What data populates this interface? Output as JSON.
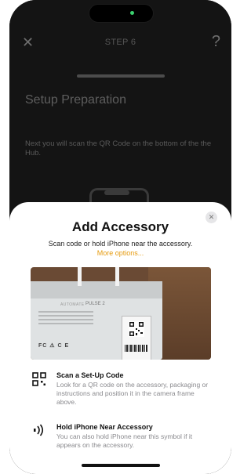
{
  "background": {
    "close_icon": "close-icon",
    "step_label": "STEP 6",
    "help_label": "?",
    "title": "Setup Preparation",
    "description": "Next you will scan the QR Code on the bottom of the the Hub."
  },
  "sheet": {
    "title": "Add Accessory",
    "subtitle": "Scan code or hold iPhone near the accessory.",
    "more_options": "More options...",
    "camera": {
      "brand": "AUTOMATE",
      "model": "PULSE 2",
      "certs": "FC ⚠ C E"
    },
    "rows": [
      {
        "icon": "qr-code-icon",
        "title": "Scan a Set-Up Code",
        "description": "Look for a QR code on the accessory, packaging or instructions and position it in the camera frame above."
      },
      {
        "icon": "nfc-icon",
        "title": "Hold iPhone Near Accessory",
        "description": "You can also hold iPhone near this symbol if it appears on the accessory."
      }
    ]
  },
  "colors": {
    "accent": "#e59a0d",
    "sheet_bg": "#ffffff",
    "dim_bg": "#141414"
  }
}
